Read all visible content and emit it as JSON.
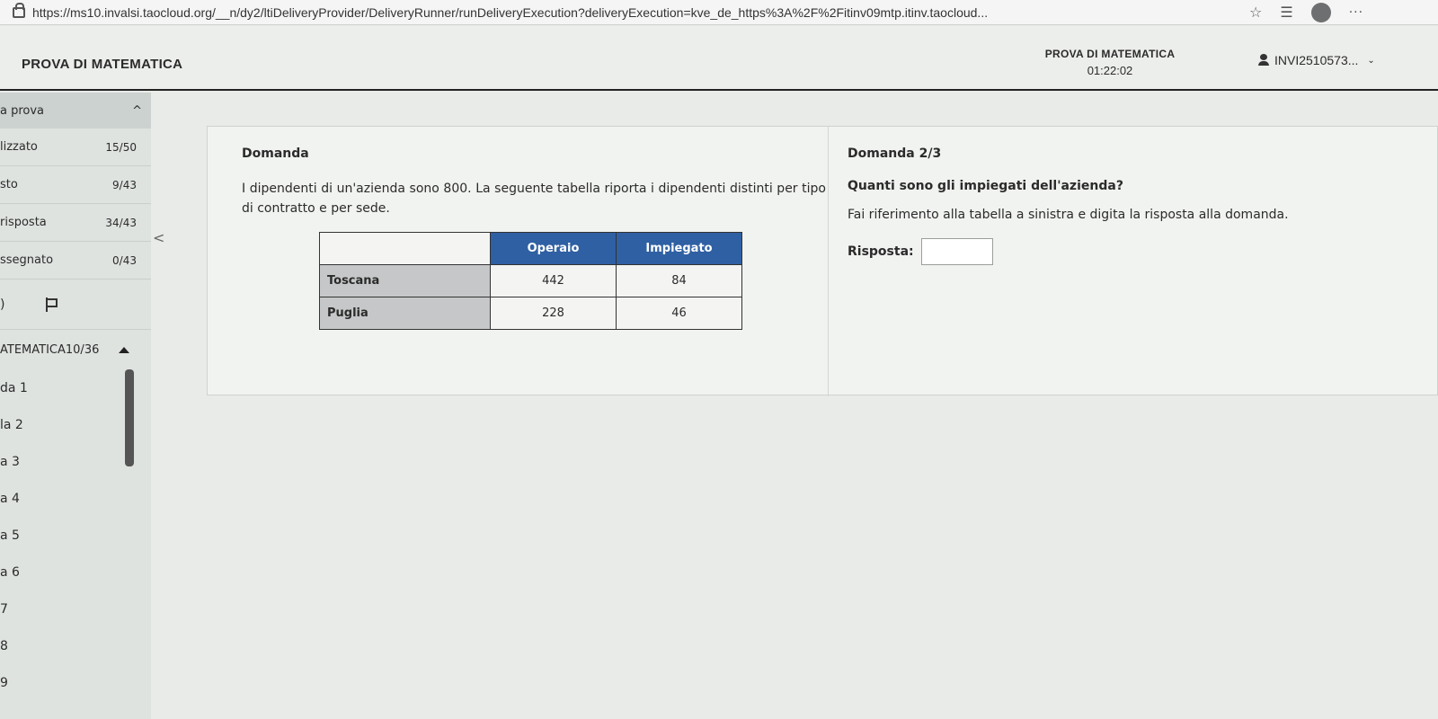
{
  "browser": {
    "url": "https://ms10.invalsi.taocloud.org/__n/dy2/ltiDeliveryProvider/DeliveryRunner/runDeliveryExecution?deliveryExecution=kve_de_https%3A%2F%2Fitinv09mtp.itinv.taocloud...",
    "star_glyph": "☆",
    "reading_glyph": "☰",
    "more_glyph": "···"
  },
  "header": {
    "app_title": "PROVA DI MATEMATICA",
    "timer_title": "PROVA DI MATEMATICA",
    "timer": "01:22:02",
    "user_id": "INVI2510573...",
    "chevron": "⌄"
  },
  "sidebar": {
    "section_label": "a prova",
    "section_chevron": "^",
    "stats": [
      {
        "label": "lizzato",
        "count": "15/50"
      },
      {
        "label": "sto",
        "count": "9/43"
      },
      {
        "label": "risposta",
        "count": "34/43"
      },
      {
        "label": "ssegnato",
        "count": "0/43"
      }
    ],
    "tool_glyph": ")",
    "part_label": "ATEMATICA",
    "part_count": "10/36",
    "items": [
      "da 1",
      "la 2",
      "a 3",
      "a 4",
      "a 5",
      "a 6",
      "7",
      "8",
      "9"
    ],
    "collapse_glyph": "<"
  },
  "main": {
    "left_heading": "Domanda",
    "intro": "I dipendenti di un'azienda sono 800. La seguente tabella riporta i dipendenti distinti per tipo di contratto e per sede.",
    "table": {
      "columns": [
        "Operaio",
        "Impiegato"
      ],
      "rows": [
        {
          "label": "Toscana",
          "values": [
            "442",
            "84"
          ]
        },
        {
          "label": "Puglia",
          "values": [
            "228",
            "46"
          ]
        }
      ]
    },
    "right_heading": "Domanda 2/3",
    "question": "Quanti sono gli impiegati dell'azienda?",
    "hint": "Fai riferimento alla tabella a sinistra e digita la risposta alla domanda.",
    "answer_label": "Risposta:",
    "answer_value": ""
  }
}
